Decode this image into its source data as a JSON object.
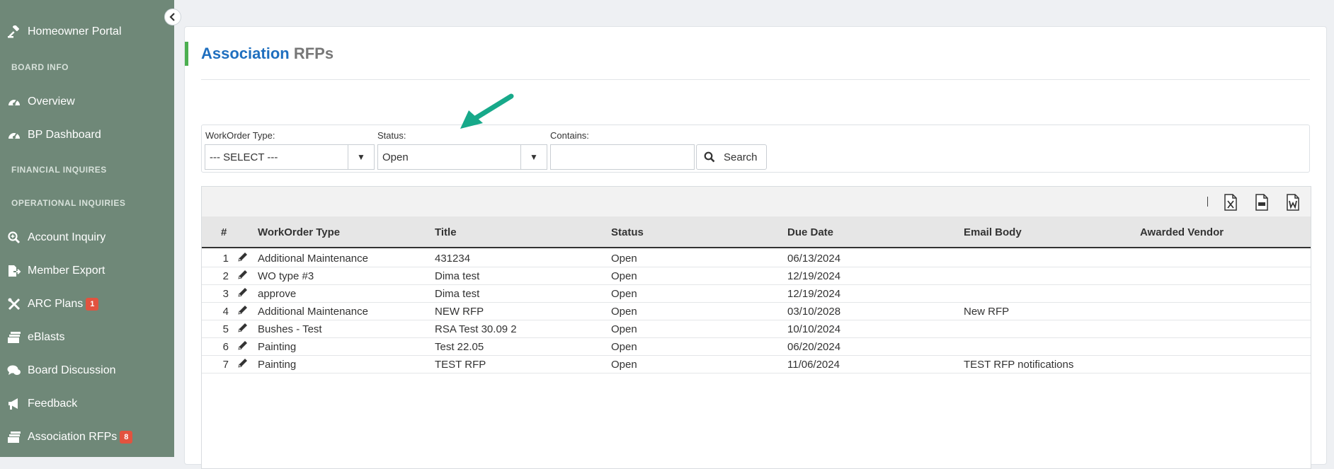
{
  "sidebar": {
    "items": [
      {
        "label": "Homeowner Portal",
        "icon": "gavel-icon"
      },
      {
        "label": "Overview",
        "icon": "dashboard-icon"
      },
      {
        "label": "BP Dashboard",
        "icon": "dashboard-icon"
      },
      {
        "label": "Account Inquiry",
        "icon": "search-plus-icon"
      },
      {
        "label": "Member Export",
        "icon": "export-icon"
      },
      {
        "label": "ARC Plans",
        "icon": "tools-icon",
        "badge": "1"
      },
      {
        "label": "eBlasts",
        "icon": "mail-stack-icon"
      },
      {
        "label": "Board Discussion",
        "icon": "comments-icon"
      },
      {
        "label": "Feedback",
        "icon": "megaphone-icon"
      },
      {
        "label": "Association RFPs",
        "icon": "rfp-icon",
        "badge": "8"
      }
    ],
    "sections": [
      "BOARD INFO",
      "FINANCIAL INQUIRES",
      "OPERATIONAL INQUIRIES"
    ]
  },
  "page": {
    "title_part1": "Association",
    "title_part2": "RFPs"
  },
  "filters": {
    "workorder_type_label": "WorkOrder Type:",
    "workorder_type_value": "--- SELECT ---",
    "status_label": "Status:",
    "status_value": "Open",
    "contains_label": "Contains:",
    "contains_value": "",
    "search_label": "Search"
  },
  "table": {
    "export_icons": [
      "excel-export-icon",
      "csv-export-icon",
      "word-export-icon"
    ],
    "columns": [
      "#",
      "WorkOrder Type",
      "Title",
      "Status",
      "Due Date",
      "Email Body",
      "Awarded Vendor"
    ],
    "rows": [
      {
        "num": "1",
        "type": "Additional Maintenance",
        "title": "431234",
        "status": "Open",
        "due": "06/13/2024",
        "email": "",
        "vendor": ""
      },
      {
        "num": "2",
        "type": "WO type #3",
        "title": "Dima test",
        "status": "Open",
        "due": "12/19/2024",
        "email": "",
        "vendor": ""
      },
      {
        "num": "3",
        "type": "approve",
        "title": "Dima test",
        "status": "Open",
        "due": "12/19/2024",
        "email": "",
        "vendor": ""
      },
      {
        "num": "4",
        "type": "Additional Maintenance",
        "title": "NEW RFP",
        "status": "Open",
        "due": "03/10/2028",
        "email": "New RFP",
        "vendor": ""
      },
      {
        "num": "5",
        "type": "Bushes - Test",
        "title": "RSA Test 30.09 2",
        "status": "Open",
        "due": "10/10/2024",
        "email": "",
        "vendor": ""
      },
      {
        "num": "6",
        "type": "Painting",
        "title": "Test 22.05",
        "status": "Open",
        "due": "06/20/2024",
        "email": "",
        "vendor": ""
      },
      {
        "num": "7",
        "type": "Painting",
        "title": "TEST RFP",
        "status": "Open",
        "due": "11/06/2024",
        "email": "TEST RFP notifications",
        "vendor": ""
      }
    ]
  },
  "colors": {
    "sidebar": "#6f8878",
    "accent": "#4caf50",
    "title_blue": "#1f6fbf",
    "badge": "#e2533f",
    "annotation_arrow": "#17a98a"
  }
}
